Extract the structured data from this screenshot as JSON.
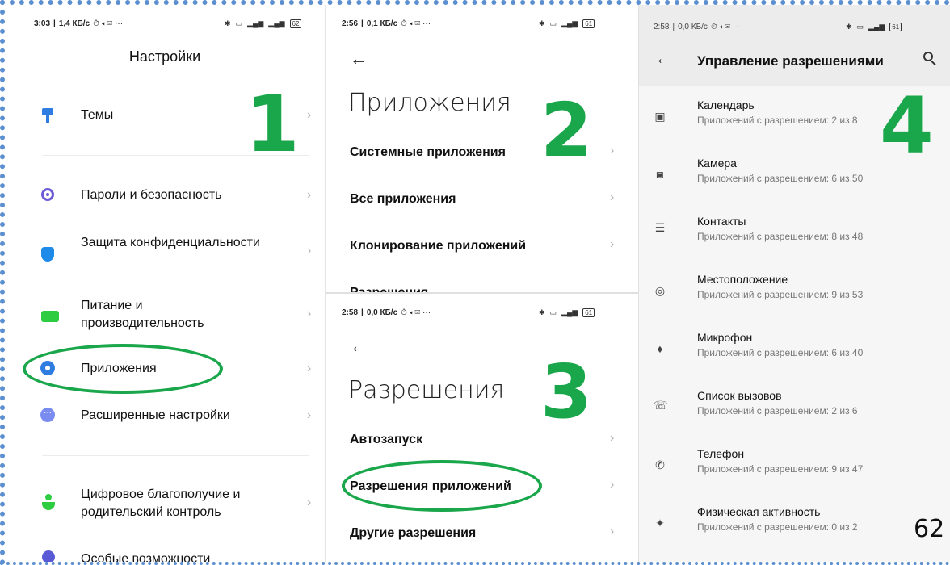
{
  "panel1": {
    "status": {
      "time": "3:03",
      "speed": "1,4 КБ/с",
      "extra": "⏱ ◂ ✉ ···",
      "battery": "62"
    },
    "title": "Настройки",
    "step": "1",
    "items": [
      {
        "label": "Темы",
        "icon": "theme-icon",
        "color": "#2f7de1"
      },
      {
        "label": "Пароли и безопасность",
        "icon": "fingerprint-icon",
        "color": "#6b5bd6"
      },
      {
        "label": "Защита конфиденциальности",
        "icon": "privacy-shield-icon",
        "color": "#1f8be8"
      },
      {
        "label": "Питание и производительность",
        "icon": "battery-icon",
        "color": "#2ecc40"
      },
      {
        "label": "Приложения",
        "icon": "gear-icon",
        "color": "#2f7de1"
      },
      {
        "label": "Расширенные настройки",
        "icon": "more-icon",
        "color": "#7a8cf0"
      },
      {
        "label": "Цифровое благополучие и родительский контроль",
        "icon": "wellbeing-icon",
        "color": "#2ecc40"
      },
      {
        "label": "Особые возможности",
        "icon": "accessibility-icon",
        "color": "#5a5ad6"
      }
    ]
  },
  "panel2": {
    "status": {
      "time": "2:56",
      "speed": "0,1 КБ/с",
      "extra": "⏱ ◂ ✉ ···",
      "battery": "61"
    },
    "title": "Приложения",
    "step": "2",
    "items": [
      {
        "label": "Системные приложения"
      },
      {
        "label": "Все приложения"
      },
      {
        "label": "Клонирование приложений"
      },
      {
        "label": "Разрешения"
      }
    ]
  },
  "panel3": {
    "status": {
      "time": "2:58",
      "speed": "0,0 КБ/с",
      "extra": "⏱ ◂ ✉ ···",
      "battery": "61"
    },
    "title": "Разрешения",
    "step": "3",
    "items": [
      {
        "label": "Автозапуск"
      },
      {
        "label": "Разрешения приложений"
      },
      {
        "label": "Другие разрешения"
      }
    ]
  },
  "panel4": {
    "status": {
      "time": "2:58",
      "speed": "0,0 КБ/с",
      "extra": "⏱ ◂ ✉ ···",
      "battery": "61"
    },
    "title": "Управление разрешениями",
    "step": "4",
    "items": [
      {
        "title": "Календарь",
        "sub": "Приложений с разрешением: 2 из 8",
        "icon": "calendar-icon"
      },
      {
        "title": "Камера",
        "sub": "Приложений с разрешением: 6 из 50",
        "icon": "camera-icon"
      },
      {
        "title": "Контакты",
        "sub": "Приложений с разрешением: 8 из 48",
        "icon": "contacts-icon"
      },
      {
        "title": "Местоположение",
        "sub": "Приложений с разрешением: 9 из 53",
        "icon": "location-icon"
      },
      {
        "title": "Микрофон",
        "sub": "Приложений с разрешением: 6 из 40",
        "icon": "microphone-icon"
      },
      {
        "title": "Список вызовов",
        "sub": "Приложений с разрешением: 2 из 6",
        "icon": "call-log-icon"
      },
      {
        "title": "Телефон",
        "sub": "Приложений с разрешением: 9 из 47",
        "icon": "phone-icon"
      },
      {
        "title": "Физическая активность",
        "sub": "Приложений с разрешением: 0 из 2",
        "icon": "activity-icon"
      }
    ]
  },
  "page_number": "62",
  "colors": {
    "accent_green": "#1aa64a",
    "frame_blue": "#5b8fd0",
    "chevron": "#b5b5b5"
  }
}
